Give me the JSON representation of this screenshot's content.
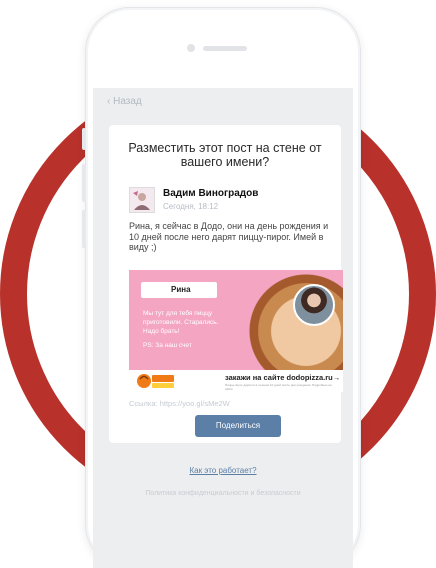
{
  "nav": {
    "back_label": "‹ Назад"
  },
  "dialog": {
    "title": "Разместить этот пост на стене от вашего имени?"
  },
  "post": {
    "author": "Вадим Виноградов",
    "time": "Сегодня, 18:12",
    "text": "Рина, я сейчас в Додо, они на день рождения и 10 дней после него дарят пиццу-пирог. Имей в виду ;)",
    "link": "Ссылка: https://yoo.gl/sMe2W"
  },
  "banner": {
    "name": "Рина",
    "line1": "Мы тут для тебя пиццу",
    "line2": "приготовили. Старались.",
    "line3": "Надо брать!",
    "ps": "PS: За наш счет",
    "logo_text": "ДОДО ПИЦЦА",
    "order": "закажи на сайте dodopizza.ru→",
    "fine_print": "Пицца-пирог дарится в течение 10 дней после дня рождения. Подробнее на сайте"
  },
  "actions": {
    "share_label": "Поделиться"
  },
  "footer": {
    "how_link": "Как это работает?",
    "policy": "Политика конфиденциальности и безопасности"
  },
  "colors": {
    "ring": "#b8312b",
    "button": "#5c7fa8",
    "banner_pink": "#f4a5c2",
    "link_blue": "#5b7fa6"
  }
}
